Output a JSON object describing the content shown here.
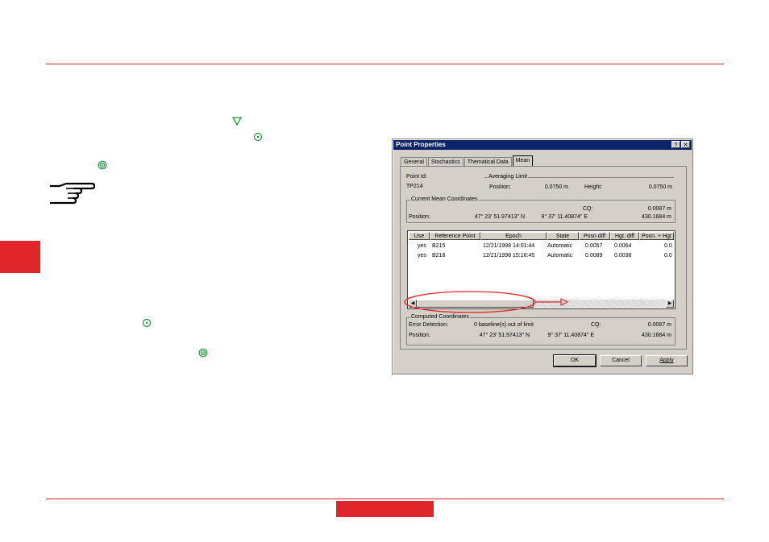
{
  "page": {
    "accent_color": "#e0262b",
    "icons": [
      "triangle-down-icon",
      "circle-dot-icon",
      "double-circle-icon",
      "pointing-hand-icon"
    ]
  },
  "dialog": {
    "title": "Point Properties",
    "help_button": "?",
    "close_button": "✕",
    "tabs": [
      "General",
      "Stochastics",
      "Thematical Data",
      "Mean"
    ],
    "point_id_label": "Point Id:",
    "point_id_value": "TP214",
    "averaging_limit": {
      "group_label": "Averaging Limit",
      "position_label": "Position:",
      "position_value": "0.0750 m",
      "height_label": "Height:",
      "height_value": "0.0750 m"
    },
    "current_mean": {
      "group_label": "Current Mean Coordinates",
      "cq_label": "CQ:",
      "cq_value": "0.0087 m",
      "position_label": "Position:",
      "lat": "47° 23' 51.97413\" N",
      "lon": "9° 37' 11.40874\" E",
      "height": "430.1684 m"
    },
    "table": {
      "columns": [
        "Use",
        "Reference Point",
        "Epoch",
        "State",
        "Posn diff",
        "Hgt. diff",
        "Posn. + Hgt"
      ],
      "rows": [
        [
          "yes",
          "B215",
          "12/21/1998 14:01:44",
          "Automatic",
          "0.0057",
          "0.0064",
          "0.0"
        ],
        [
          "yes",
          "B218",
          "12/21/1998 15:16:45",
          "Automatic",
          "0.0089",
          "0.0038",
          "0.0"
        ]
      ]
    },
    "computed": {
      "group_label": "Computed Coordinates",
      "error_label": "Error Detection:",
      "error_value": "0 baseline(s) out of limit",
      "cq_label": "CQ:",
      "cq_value": "0.0087 m",
      "position_label": "Position:",
      "lat": "47° 23' 51.97413\" N",
      "lon": "9° 37' 11.40874\" E",
      "height": "430.1684 m"
    },
    "buttons": {
      "ok": "OK",
      "cancel": "Cancel",
      "apply": "Apply"
    }
  }
}
